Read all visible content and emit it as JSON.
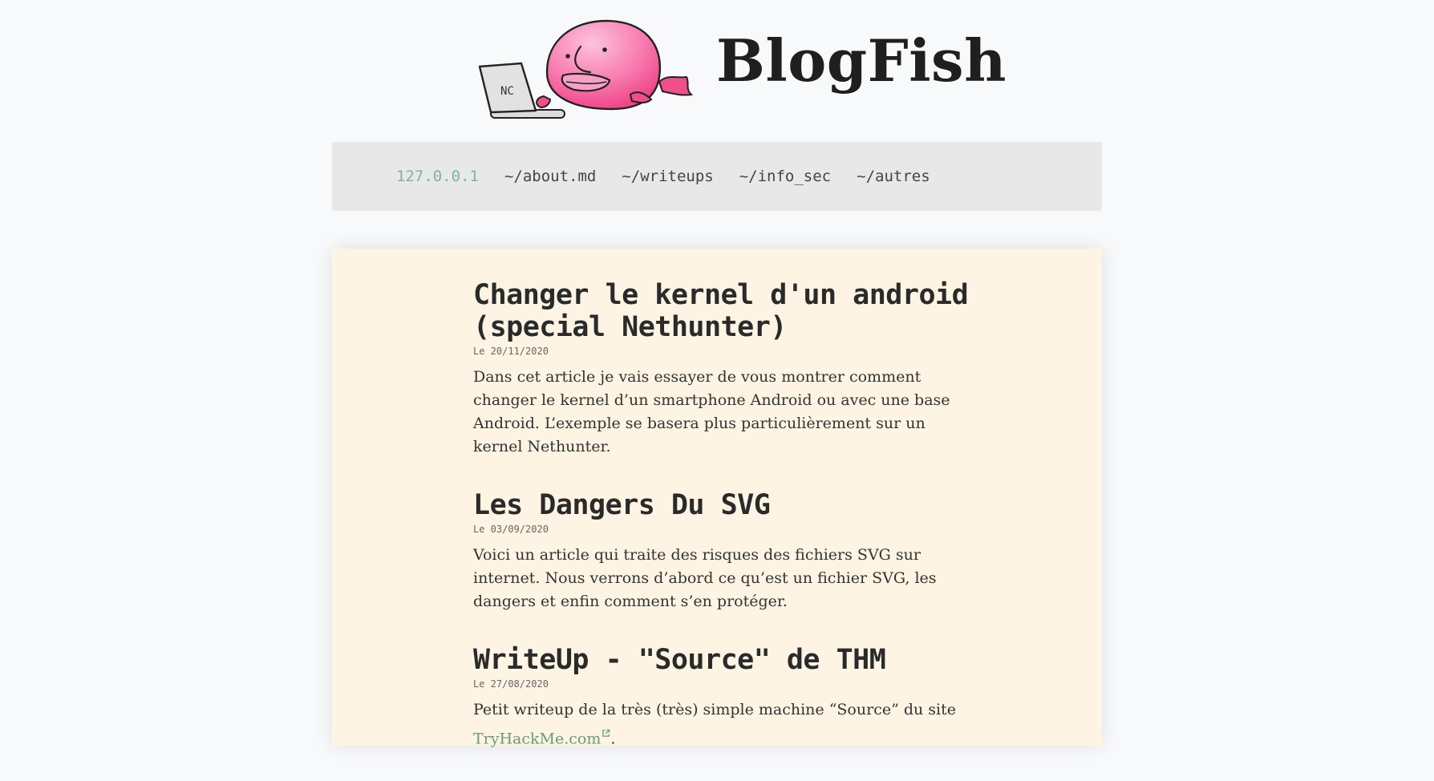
{
  "site": {
    "title": "BlogFish"
  },
  "nav": {
    "items": [
      {
        "label": "127.0.0.1"
      },
      {
        "label": "~/about.md"
      },
      {
        "label": "~/writeups"
      },
      {
        "label": "~/info_sec"
      },
      {
        "label": "~/autres"
      }
    ]
  },
  "posts": [
    {
      "title": "Changer le kernel d'un android (special Nethunter)",
      "date": "Le 20/11/2020",
      "excerpt": "Dans cet article je vais essayer de vous montrer comment changer le kernel d’un smartphone Android ou avec une base Android. L’exemple se basera plus particulièrement sur un kernel Nethunter."
    },
    {
      "title": "Les Dangers Du SVG",
      "date": "Le 03/09/2020",
      "excerpt": "Voici un article qui traite des risques des fichiers SVG sur internet. Nous verrons d’abord ce qu’est un fichier SVG, les dangers et enfin comment s’en protéger."
    },
    {
      "title": "WriteUp - \"Source\" de THM",
      "date": "Le 27/08/2020",
      "excerpt_before": "Petit writeup de la très (très) simple machine “Source” du site",
      "link": "TryHackMe.com",
      "excerpt_after": "."
    }
  ],
  "colors": {
    "page_background": "#f8f9fa",
    "nav_background": "#e8e8e8",
    "card_background": "#fdf4e3",
    "accent_green": "#7fb597",
    "link_green": "#6a9b76",
    "fish_pink": "#f24f8e"
  },
  "icons": {
    "logo": "blobfish-laptop-logo",
    "external_link": "external-link-icon"
  }
}
